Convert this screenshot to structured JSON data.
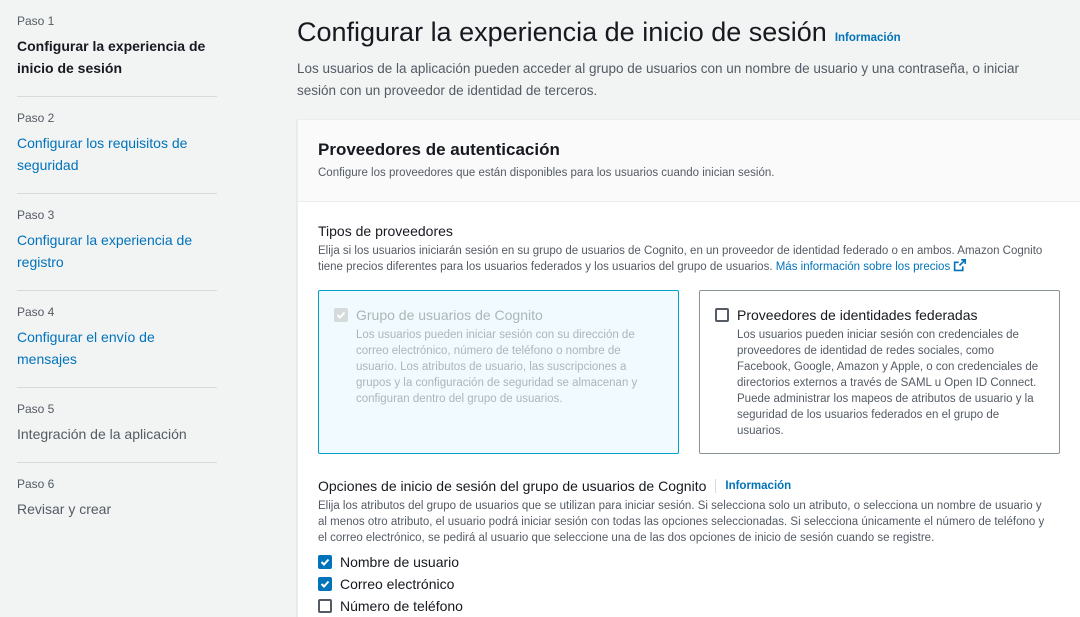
{
  "sidebar": {
    "steps": [
      {
        "num": "Paso 1",
        "title": "Configurar la experiencia de inicio de sesión"
      },
      {
        "num": "Paso 2",
        "title": "Configurar los requisitos de seguridad"
      },
      {
        "num": "Paso 3",
        "title": "Configurar la experiencia de registro"
      },
      {
        "num": "Paso 4",
        "title": "Configurar el envío de mensajes"
      },
      {
        "num": "Paso 5",
        "title": "Integración de la aplicación"
      },
      {
        "num": "Paso 6",
        "title": "Revisar y crear"
      }
    ]
  },
  "header": {
    "title": "Configurar la experiencia de inicio de sesión",
    "info": "Información",
    "description": "Los usuarios de la aplicación pueden acceder al grupo de usuarios con un nombre de usuario y una contraseña, o iniciar sesión con un proveedor de identidad de terceros."
  },
  "panel": {
    "title": "Proveedores de autenticación",
    "subtitle": "Configure los proveedores que están disponibles para los usuarios cuando inician sesión.",
    "provider_types": {
      "label": "Tipos de proveedores",
      "description": "Elija si los usuarios iniciarán sesión en su grupo de usuarios de Cognito, en un proveedor de identidad federado o en ambos. Amazon Cognito tiene precios diferentes para los usuarios federados y los usuarios del grupo de usuarios.",
      "pricing_link": "Más información sobre los precios",
      "tiles": [
        {
          "title": "Grupo de usuarios de Cognito",
          "description": "Los usuarios pueden iniciar sesión con su dirección de correo electrónico, número de teléfono o nombre de usuario. Los atributos de usuario, las suscripciones a grupos y la configuración de seguridad se almacenan y configuran dentro del grupo de usuarios.",
          "checked": true
        },
        {
          "title": "Proveedores de identidades federadas",
          "description": "Los usuarios pueden iniciar sesión con credenciales de proveedores de identidad de redes sociales, como Facebook, Google, Amazon y Apple, o con credenciales de directorios externos a través de SAML u Open ID Connect. Puede administrar los mapeos de atributos de usuario y la seguridad de los usuarios federados en el grupo de usuarios.",
          "checked": false
        }
      ]
    },
    "signin_options": {
      "label": "Opciones de inicio de sesión del grupo de usuarios de Cognito",
      "info": "Información",
      "description": "Elija los atributos del grupo de usuarios que se utilizan para iniciar sesión. Si selecciona solo un atributo, o selecciona un nombre de usuario y al menos otro atributo, el usuario podrá iniciar sesión con todas las opciones seleccionadas. Si selecciona únicamente el número de teléfono y el correo electrónico, se pedirá al usuario que seleccione una de las dos opciones de inicio de sesión cuando se registre.",
      "options": [
        {
          "label": "Nombre de usuario",
          "checked": true
        },
        {
          "label": "Correo electrónico",
          "checked": true
        },
        {
          "label": "Número de teléfono",
          "checked": false
        }
      ]
    }
  },
  "colors": {
    "link": "#0073bb",
    "selected_tile_bg": "#f1faff",
    "selected_tile_border": "#00a1c9",
    "background": "#f2f3f3"
  }
}
